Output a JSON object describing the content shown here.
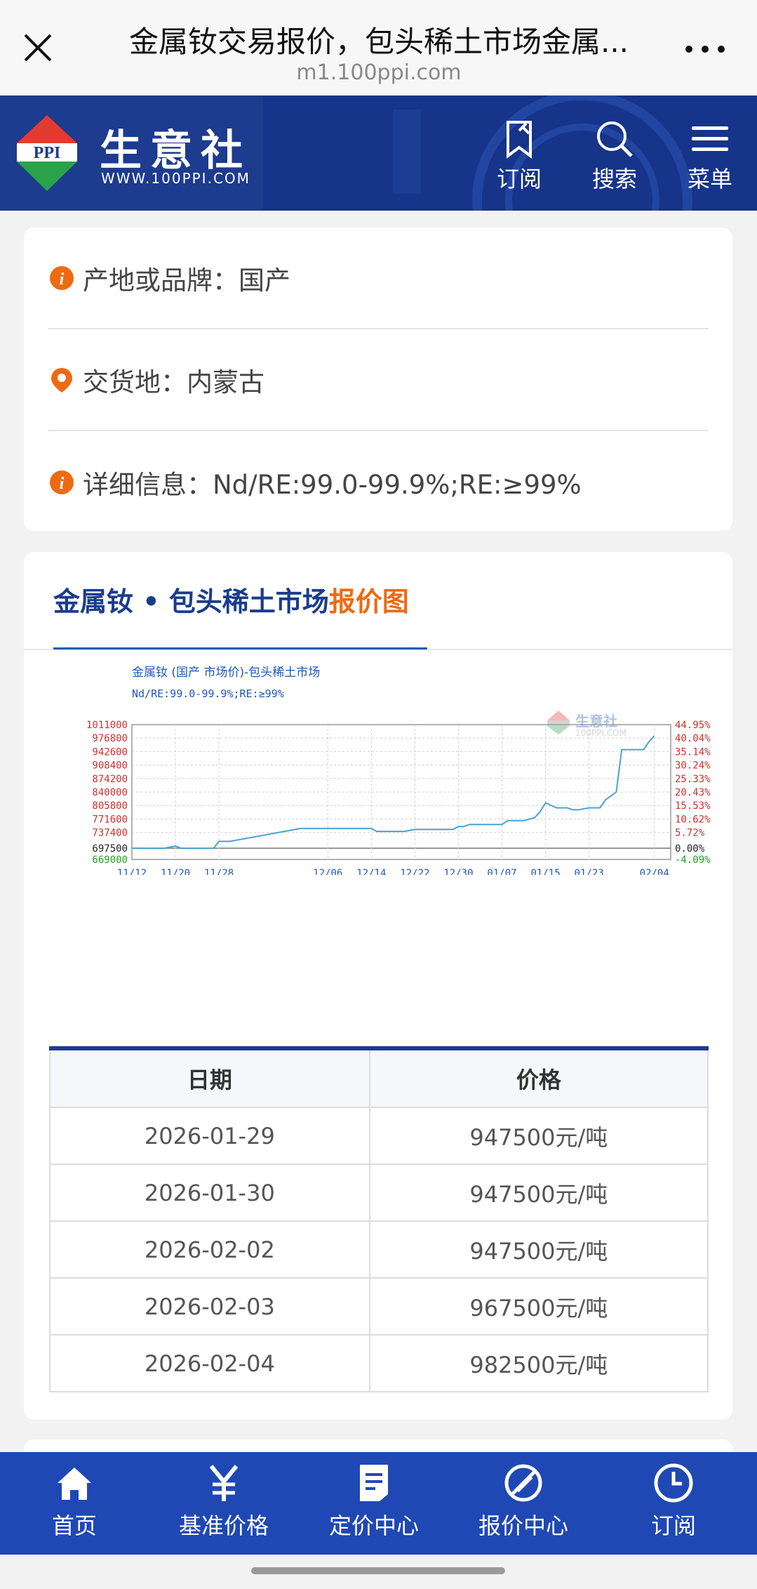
{
  "topbar": {
    "title": "金属钕交易报价，包头稀土市场金属...",
    "url": "m1.100ppi.com"
  },
  "header": {
    "logo_abbr": "PPI",
    "logo_cn": "生意社",
    "logo_en": "WWW.100PPI.COM",
    "buttons": [
      {
        "label": "订阅",
        "icon": "subscribe-icon"
      },
      {
        "label": "搜索",
        "icon": "search-icon"
      },
      {
        "label": "菜单",
        "icon": "menu-icon"
      }
    ]
  },
  "info": [
    {
      "icon": "info-icon",
      "label": "产地或品牌：",
      "value": "国产"
    },
    {
      "icon": "location-pin-icon",
      "label": "交货地：",
      "value": "内蒙古"
    },
    {
      "icon": "info-icon",
      "label": "详细信息：",
      "value": "Nd/RE:99.0-99.9%;RE:≥99%"
    }
  ],
  "chart_section": {
    "heading_main": "金属钕 • 包头稀土市场",
    "heading_highlight": "报价图"
  },
  "chart_data": {
    "type": "line",
    "title": "金属钕 (国产 市场价)-包头稀土市场",
    "subtitle": "Nd/RE:99.0-99.9%;RE:≥99%",
    "watermark": "生意社 100PPI.COM",
    "x_ticks": [
      "11/12",
      "11/20",
      "11/28",
      "12/06",
      "12/14",
      "12/22",
      "12/30",
      "01/07",
      "01/15",
      "01/23",
      "02/04"
    ],
    "y_left_ticks": [
      "1011000",
      "976800",
      "942600",
      "908400",
      "874200",
      "840000",
      "805800",
      "771600",
      "737400",
      "697500",
      "669000"
    ],
    "y_right_ticks": [
      "44.95%",
      "40.04%",
      "35.14%",
      "30.24%",
      "25.33%",
      "20.43%",
      "15.53%",
      "10.62%",
      "5.72%",
      "0.00%",
      "-4.09%"
    ],
    "ylim": [
      669000,
      1011000
    ],
    "baseline": 697500,
    "colors": {
      "line": "#4aa3d0",
      "left_axis": "#d03030",
      "baseline_label": "#222222",
      "bottom_label": "#22a022",
      "grid": "#d0d0d0"
    },
    "series": [
      {
        "x": [
          "11/12",
          "11/15",
          "11/18",
          "11/20",
          "11/21",
          "11/24",
          "11/27",
          "11/28",
          "11/30",
          "12/01",
          "12/06",
          "12/10",
          "12/14",
          "12/15",
          "12/20",
          "12/22",
          "12/26",
          "12/29",
          "12/30",
          "12/31",
          "01/01",
          "01/07",
          "01/08",
          "01/11",
          "01/13",
          "01/14",
          "01/15",
          "01/17",
          "01/19",
          "01/20",
          "01/21",
          "01/23",
          "01/24",
          "01/25",
          "01/26",
          "01/27",
          "01/28",
          "01/29",
          "01/30",
          "02/02",
          "02/03",
          "02/04"
        ],
        "y": [
          697500,
          697500,
          697500,
          703000,
          697500,
          697500,
          697500,
          715000,
          715000,
          747500,
          747500,
          747500,
          747500,
          740000,
          740000,
          745000,
          745000,
          745000,
          752500,
          752500,
          757500,
          757500,
          767500,
          767500,
          775000,
          790000,
          812500,
          800000,
          800000,
          795000,
          795000,
          800000,
          800000,
          800000,
          820000,
          830000,
          840000,
          947500,
          947500,
          947500,
          967500,
          982500
        ]
      }
    ]
  },
  "table": {
    "headers": [
      "日期",
      "价格"
    ],
    "rows": [
      {
        "date": "2026-01-29",
        "price": "947500元/吨"
      },
      {
        "date": "2026-01-30",
        "price": "947500元/吨"
      },
      {
        "date": "2026-02-02",
        "price": "947500元/吨"
      },
      {
        "date": "2026-02-03",
        "price": "967500元/吨"
      },
      {
        "date": "2026-02-04",
        "price": "982500元/吨"
      }
    ]
  },
  "bottom_nav": [
    {
      "label": "首页",
      "icon": "home-icon"
    },
    {
      "label": "基准价格",
      "icon": "yen-icon"
    },
    {
      "label": "定价中心",
      "icon": "document-icon"
    },
    {
      "label": "报价中心",
      "icon": "quote-slash-icon"
    },
    {
      "label": "订阅",
      "icon": "clock-icon"
    }
  ]
}
